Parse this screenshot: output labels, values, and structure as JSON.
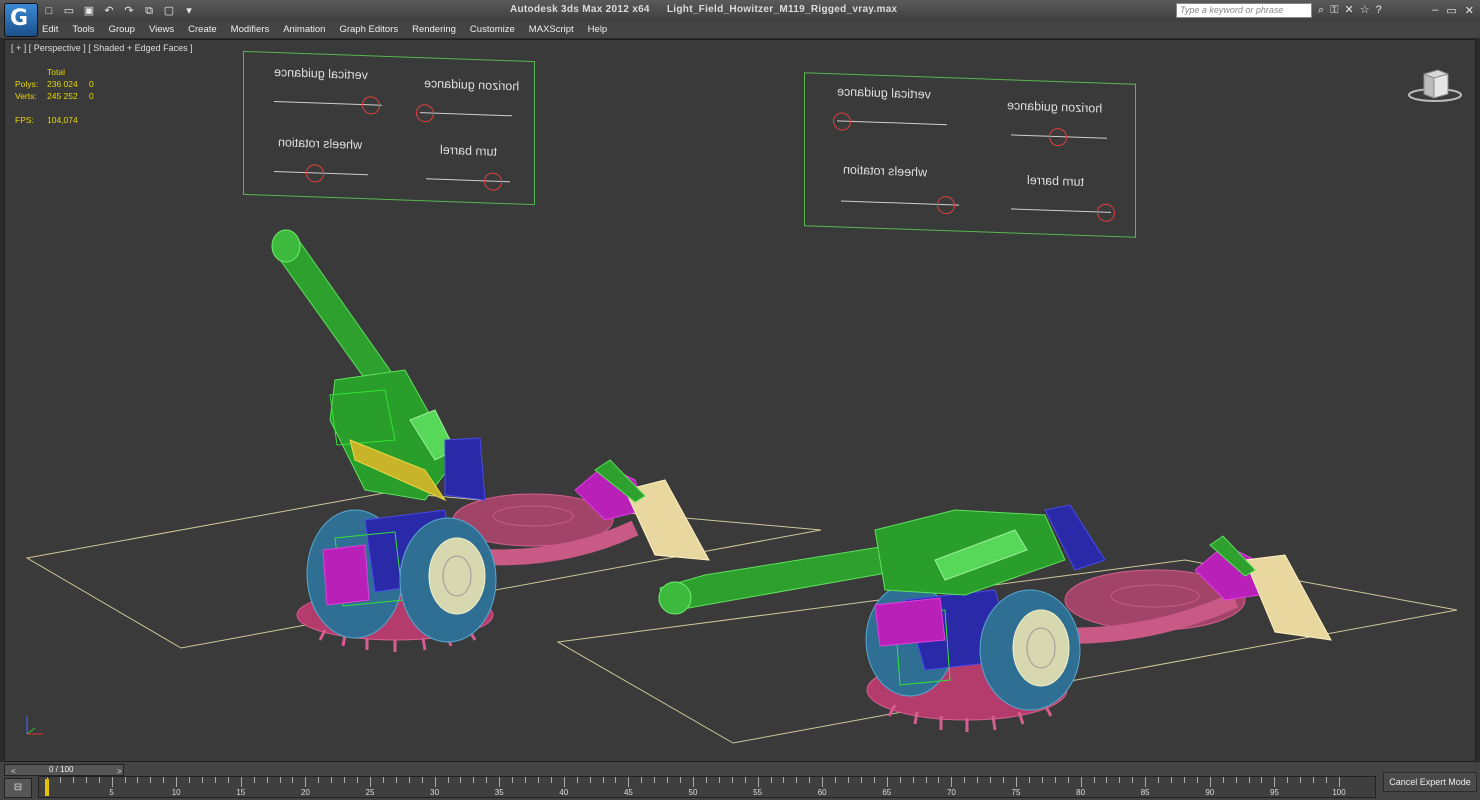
{
  "app": {
    "title_app": "Autodesk 3ds Max  2012 x64",
    "title_file": "Light_Field_Howitzer_M119_Rigged_vray.max",
    "logo_glyph": "G"
  },
  "quick_access": [
    "new-icon",
    "open-icon",
    "save-icon",
    "undo-icon",
    "redo-icon",
    "project-icon",
    "window-icon",
    "dropdown-icon"
  ],
  "search": {
    "placeholder": "Type a keyword or phrase"
  },
  "menu": [
    "Edit",
    "Tools",
    "Group",
    "Views",
    "Create",
    "Modifiers",
    "Animation",
    "Graph Editors",
    "Rendering",
    "Customize",
    "MAXScript",
    "Help"
  ],
  "viewport": {
    "label": "[ + ] [ Perspective ] [ Shaded + Edged Faces ]",
    "stats": {
      "header": "Total",
      "polys_label": "Polys:",
      "polys_value": "236 024",
      "polys_sel": "0",
      "verts_label": "Verts:",
      "verts_value": "245 252",
      "verts_sel": "0",
      "fps_label": "FPS:",
      "fps_value": "104,074"
    }
  },
  "rig_panel_left": {
    "labels": [
      "vertical guidance",
      "horizon guidance",
      "wheels rotation",
      "turn barrel"
    ]
  },
  "rig_panel_right": {
    "labels": [
      "vertical guidance",
      "horizon guidance",
      "wheels rotation",
      "turn barrel"
    ]
  },
  "timeline": {
    "frame_label": "0 / 100",
    "ticks": [
      "5",
      "10",
      "15",
      "20",
      "25",
      "30",
      "35",
      "40",
      "45",
      "50",
      "55",
      "60",
      "65",
      "70",
      "75",
      "80",
      "85",
      "90",
      "95",
      "100"
    ],
    "cancel_label": "Cancel Expert Mode"
  },
  "colors": {
    "accent": "#e8d800",
    "viewport_bg": "#3a3a3a",
    "rig_border": "#56b84e",
    "knob": "#e04040"
  }
}
